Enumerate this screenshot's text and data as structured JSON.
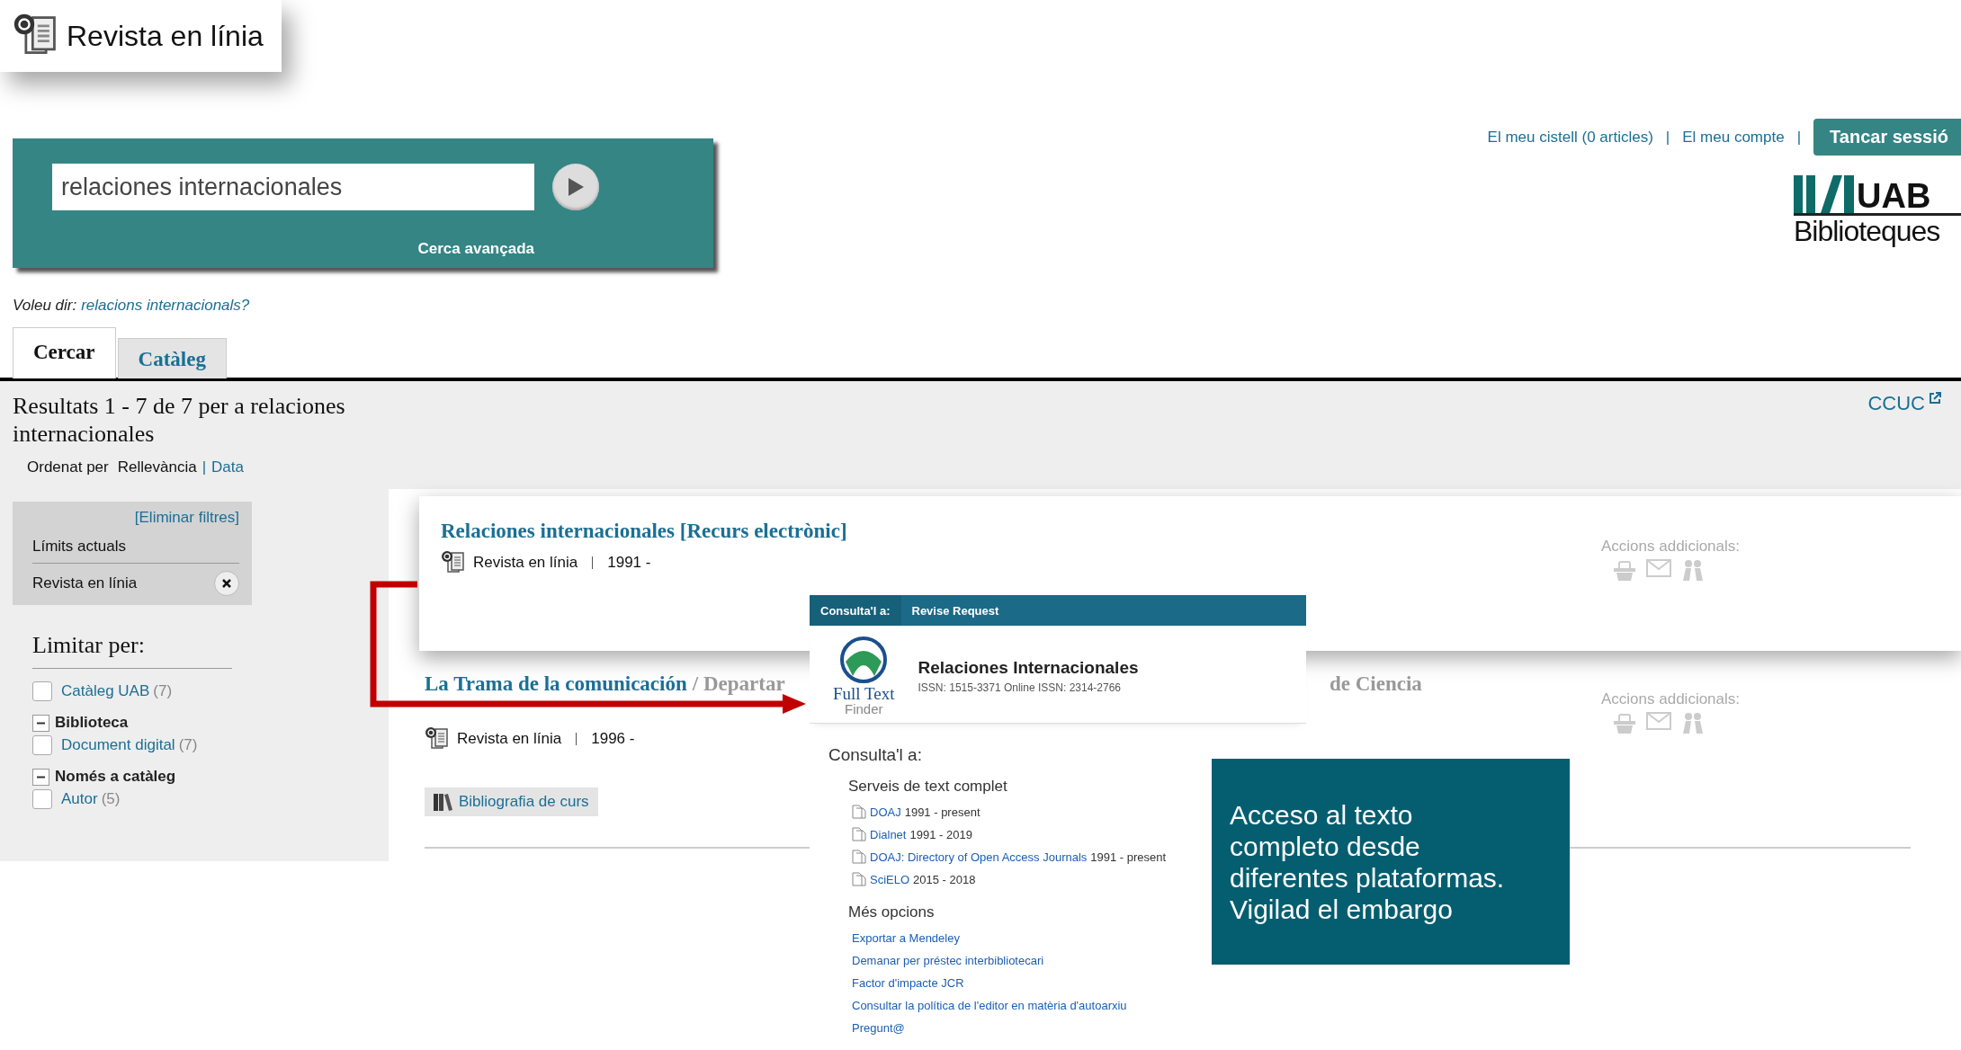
{
  "badge": {
    "label": "Revista en línia"
  },
  "search": {
    "value": "relaciones internacionales",
    "advanced_link": "Cerca avançada"
  },
  "suggestion": {
    "prefix": "Voleu dir:",
    "link": "relacions internacionals?"
  },
  "user_nav": [
    {
      "kind": "link",
      "label": "El meu cistell (0 articles)"
    },
    {
      "kind": "separator",
      "label": "|"
    },
    {
      "kind": "link",
      "label": "El meu compte"
    },
    {
      "kind": "separator",
      "label": "|"
    },
    {
      "kind": "button",
      "label": "Tancar sessió"
    }
  ],
  "logo": {
    "mark": "UAB",
    "text": "Biblioteques"
  },
  "tabs": [
    {
      "label": "Cercar",
      "selected": true
    },
    {
      "label": "Catàleg",
      "selected": false
    }
  ],
  "results_header": {
    "summary": "Resultats 1 - 7 de 7 per a relaciones internacionales",
    "external_link": "CCUC"
  },
  "sort": {
    "label": "Ordenat per",
    "separator": "|",
    "options": [
      {
        "label": "Rellevància",
        "selected": true
      },
      {
        "label": "Data",
        "selected": false
      }
    ]
  },
  "current_limits": {
    "clear_link": "[Eliminar filtres]",
    "title": "Límits actuals",
    "items": [
      {
        "label": "Revista en línia"
      }
    ]
  },
  "facets": {
    "title": "Limitar per:",
    "groups": [
      {
        "kind": "plain",
        "options": [
          {
            "label": "Catàleg UAB",
            "count": "(7)",
            "checked": false
          }
        ]
      },
      {
        "kind": "collapsible",
        "title": "Biblioteca",
        "expanded": true,
        "options": [
          {
            "label": "Document digital",
            "count": "(7)",
            "checked": false
          }
        ]
      },
      {
        "kind": "collapsible",
        "title": "Només a catàleg",
        "expanded": true,
        "options": [
          {
            "label": "Autor",
            "count": "(5)",
            "checked": false
          }
        ]
      }
    ]
  },
  "results": [
    {
      "highlighted": true,
      "title": "Relaciones internacionales [Recurs electrònic]",
      "format": "Revista en línia",
      "date": "1991 -",
      "actions_label": "Accions addicionals:"
    },
    {
      "highlighted": false,
      "title": "La Trama de la comunicación",
      "author": "/ Departar",
      "author_tail": "de Ciencia",
      "format": "Revista en línia",
      "date": "1996 -",
      "extra_button": "Bibliografia de curs",
      "actions_label": "Accions addicionals:"
    }
  ],
  "popup": {
    "tabs": [
      {
        "label": "Consulta'l a:",
        "selected": true
      },
      {
        "label": "Revise Request",
        "selected": false
      }
    ],
    "logo": {
      "line1": "Full Text",
      "line2": "Finder"
    },
    "title": "Relaciones Internacionales",
    "issn": "ISSN: 1515-3371 Online ISSN: 2314-2766",
    "section_title": "Consulta'l a:",
    "fulltext_title": "Serveis de text complet",
    "sources": [
      {
        "name": "DOAJ",
        "range": "1991 - present"
      },
      {
        "name": "Dialnet",
        "range": "1991 - 2019"
      },
      {
        "name": "DOAJ: Directory of Open Access Journals",
        "range": "1991 - present"
      },
      {
        "name": "SciELO",
        "range": "2015 - 2018"
      }
    ],
    "more_title": "Més opcions",
    "more_links": [
      "Exportar a Mendeley",
      "Demanar per préstec interbibliotecari",
      "Factor d'impacte JCR",
      "Consultar la política de l'editor en matèria d'autoarxiu",
      "Pregunt@"
    ]
  },
  "callout": {
    "text": "Acceso al texto completo desde diferentes plataformas. Vigilad el embargo"
  }
}
